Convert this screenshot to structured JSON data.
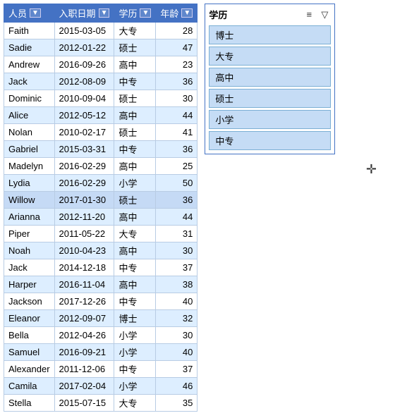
{
  "table": {
    "headers": [
      {
        "label": "人员",
        "key": "name"
      },
      {
        "label": "入职日期",
        "key": "date"
      },
      {
        "label": "学历",
        "key": "edu"
      },
      {
        "label": "年龄",
        "key": "age"
      }
    ],
    "rows": [
      {
        "name": "Faith",
        "date": "2015-03-05",
        "edu": "大专",
        "age": 28
      },
      {
        "name": "Sadie",
        "date": "2012-01-22",
        "edu": "硕士",
        "age": 47
      },
      {
        "name": "Andrew",
        "date": "2016-09-26",
        "edu": "高中",
        "age": 23
      },
      {
        "name": "Jack",
        "date": "2012-08-09",
        "edu": "中专",
        "age": 36
      },
      {
        "name": "Dominic",
        "date": "2010-09-04",
        "edu": "硕士",
        "age": 30
      },
      {
        "name": "Alice",
        "date": "2012-05-12",
        "edu": "高中",
        "age": 44
      },
      {
        "name": "Nolan",
        "date": "2010-02-17",
        "edu": "硕士",
        "age": 41
      },
      {
        "name": "Gabriel",
        "date": "2015-03-31",
        "edu": "中专",
        "age": 36
      },
      {
        "name": "Madelyn",
        "date": "2016-02-29",
        "edu": "高中",
        "age": 25
      },
      {
        "name": "Lydia",
        "date": "2016-02-29",
        "edu": "小学",
        "age": 50
      },
      {
        "name": "Willow",
        "date": "2017-01-30",
        "edu": "硕士",
        "age": 36,
        "highlighted": true
      },
      {
        "name": "Arianna",
        "date": "2012-11-20",
        "edu": "高中",
        "age": 44
      },
      {
        "name": "Piper",
        "date": "2011-05-22",
        "edu": "大专",
        "age": 31
      },
      {
        "name": "Noah",
        "date": "2010-04-23",
        "edu": "高中",
        "age": 30
      },
      {
        "name": "Jack",
        "date": "2014-12-18",
        "edu": "中专",
        "age": 37
      },
      {
        "name": "Harper",
        "date": "2016-11-04",
        "edu": "高中",
        "age": 38
      },
      {
        "name": "Jackson",
        "date": "2017-12-26",
        "edu": "中专",
        "age": 40
      },
      {
        "name": "Eleanor",
        "date": "2012-09-07",
        "edu": "博士",
        "age": 32
      },
      {
        "name": "Bella",
        "date": "2012-04-26",
        "edu": "小学",
        "age": 30
      },
      {
        "name": "Samuel",
        "date": "2016-09-21",
        "edu": "小学",
        "age": 40
      },
      {
        "name": "Alexander",
        "date": "2011-12-06",
        "edu": "中专",
        "age": 37
      },
      {
        "name": "Camila",
        "date": "2017-02-04",
        "edu": "小学",
        "age": 46
      },
      {
        "name": "Stella",
        "date": "2015-07-15",
        "edu": "大专",
        "age": 35
      }
    ]
  },
  "filter": {
    "title": "学历",
    "sort_icon": "≡",
    "funnel_icon": "▼",
    "items": [
      "博士",
      "大专",
      "高中",
      "硕士",
      "小学",
      "中专"
    ]
  }
}
